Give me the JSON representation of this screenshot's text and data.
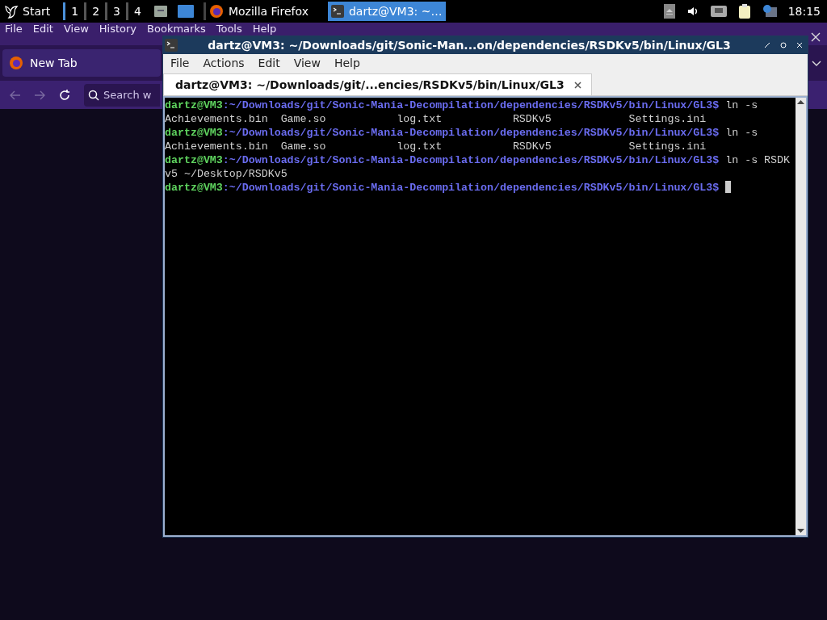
{
  "taskbar": {
    "start": "Start",
    "workspaces": [
      {
        "label": "1",
        "selected": true
      },
      {
        "label": "2",
        "selected": false
      },
      {
        "label": "3",
        "selected": false
      },
      {
        "label": "4",
        "selected": false
      }
    ],
    "tasks": [
      {
        "label": "Mozilla Firefox",
        "kind": "browser",
        "selected": false
      },
      {
        "label": "dartz@VM3: ~…",
        "kind": "terminal",
        "selected": true
      }
    ],
    "clock": "18:15"
  },
  "browser": {
    "menu": [
      "File",
      "Edit",
      "View",
      "History",
      "Bookmarks",
      "Tools",
      "Help"
    ],
    "tab": "New Tab",
    "search_placeholder": "Search w"
  },
  "terminal": {
    "title": "dartz@VM3: ~/Downloads/git/Sonic-Man...on/dependencies/RSDKv5/bin/Linux/GL3",
    "menu": [
      "File",
      "Actions",
      "Edit",
      "View",
      "Help"
    ],
    "tab": "dartz@VM3: ~/Downloads/git/...encies/RSDKv5/bin/Linux/GL3",
    "lines": [
      {
        "kind": "prompt",
        "user": "dartz@VM3",
        "path": ":~/Downloads/git/Sonic-Mania-Decompilation/dependencies/RSDKv5/bin/Linux/GL3$",
        "command": "ln -s"
      },
      {
        "kind": "output",
        "text": "Achievements.bin  Game.so           log.txt           RSDKv5            Settings.ini"
      },
      {
        "kind": "prompt",
        "user": "dartz@VM3",
        "path": ":~/Downloads/git/Sonic-Mania-Decompilation/dependencies/RSDKv5/bin/Linux/GL3$",
        "command": "ln -s"
      },
      {
        "kind": "output",
        "text": "Achievements.bin  Game.so           log.txt           RSDKv5            Settings.ini"
      },
      {
        "kind": "prompt",
        "user": "dartz@VM3",
        "path": ":~/Downloads/git/Sonic-Mania-Decompilation/dependencies/RSDKv5/bin/Linux/GL3$",
        "command": "ln -s RSDK"
      },
      {
        "kind": "output",
        "text": "v5 ~/Desktop/RSDKv5"
      },
      {
        "kind": "prompt",
        "user": "dartz@VM3",
        "path": ":~/Downloads/git/Sonic-Mania-Decompilation/dependencies/RSDKv5/bin/Linux/GL3$",
        "cursor": true
      }
    ]
  }
}
